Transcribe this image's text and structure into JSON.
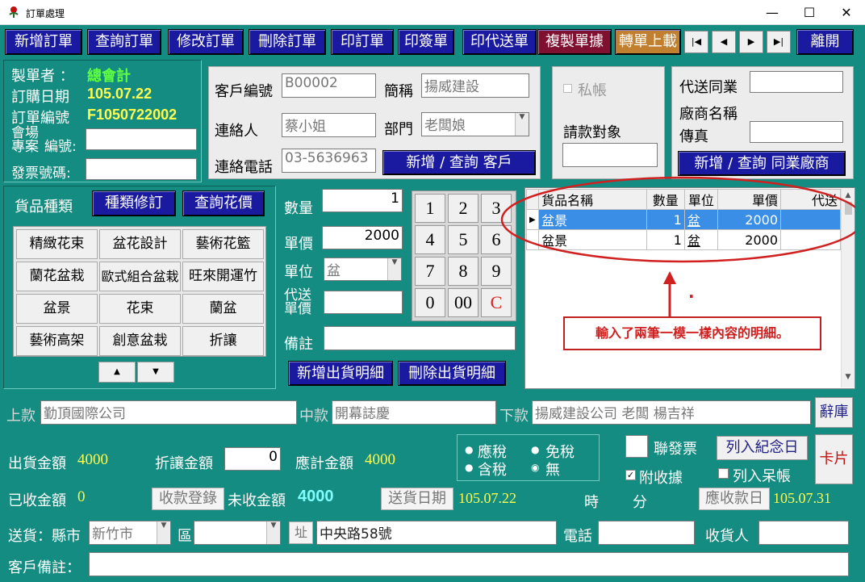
{
  "window": {
    "title": "訂單處理",
    "minimize": "—",
    "maximize": "☐",
    "close": "✕"
  },
  "toolbar": {
    "new_order": "新增訂單",
    "query_order": "查詢訂單",
    "edit_order": "修改訂單",
    "delete_order": "刪除訂單",
    "print_order": "印訂單",
    "print_sign": "印簽單",
    "print_proxy": "印代送單",
    "copy_doc": "複製單據",
    "transfer_upload": "轉單上載",
    "leave": "離開",
    "nav_first": "|◀",
    "nav_prev": "◀",
    "nav_next": "▶",
    "nav_last": "▶|"
  },
  "info": {
    "maker_label": "製單者 ：",
    "maker_value": "總會計",
    "date_label": "訂購日期",
    "date_value": "105.07.22",
    "no_label": "訂單編號",
    "no_value": "F1050722002",
    "venue_label1": "會場",
    "venue_label2": "專案",
    "venue_label3": "編號:",
    "venue_value": "",
    "invoice_label": "發票號碼:",
    "invoice_value": ""
  },
  "customer": {
    "id_label": "客戶編號",
    "id_value": "B00002",
    "short_label": "簡稱",
    "short_value": "揚威建設",
    "contact_label": "連絡人",
    "contact_value": "蔡小姐",
    "dept_label": "部門",
    "dept_value": "老闆娘",
    "phone_label": "連絡電話",
    "phone_value": "03-5636963",
    "add_query_btn": "新增 / 查詢  客戶"
  },
  "billing": {
    "private_label": "私帳",
    "target_label": "請款對象",
    "target_value": ""
  },
  "peer": {
    "peer_label": "代送同業",
    "peer_value": "",
    "vendor_label": "廠商名稱",
    "fax_label": "傳真",
    "fax_value": "",
    "add_query_btn": "新增 / 查詢  同業廠商"
  },
  "goods": {
    "category_label": "貨品種類",
    "revise_btn": "種類修訂",
    "price_btn": "查詢花價",
    "categories": [
      "精緻花束",
      "盆花設計",
      "藝術花籃",
      "蘭花盆栽",
      "歐式組合盆栽",
      "旺來開運竹",
      "盆景",
      "花束",
      "蘭盆",
      "藝術高架",
      "創意盆栽",
      "折讓"
    ],
    "scroll_up": "▲",
    "scroll_down": "▼"
  },
  "entry": {
    "qty_label": "數量",
    "qty_value": "1",
    "price_label": "單價",
    "price_value": "2000",
    "unit_label": "單位",
    "unit_value": "盆",
    "proxy_label1": "代送",
    "proxy_label2": "單價",
    "proxy_value": "",
    "note_label": "備註",
    "note_value": "",
    "add_btn": "新增出貨明細",
    "delete_btn": "刪除出貨明細"
  },
  "keypad": [
    "1",
    "2",
    "3",
    "4",
    "5",
    "6",
    "7",
    "8",
    "9",
    "0",
    "00",
    "C"
  ],
  "grid": {
    "headers": [
      "貨品名稱",
      "數量",
      "單位",
      "單價",
      "代送"
    ],
    "rows": [
      {
        "name": "盆景",
        "qty": "1",
        "unit": "盆",
        "price": "2000",
        "proxy": ""
      },
      {
        "name": "盆景",
        "qty": "1",
        "unit": "盆",
        "price": "2000",
        "proxy": ""
      }
    ]
  },
  "annotation": {
    "text": "輸入了兩筆一模一樣內容的明細。",
    "dot": "."
  },
  "greeting": {
    "upper_label": "上款",
    "upper_value": "勤頂國際公司",
    "middle_label": "中款",
    "middle_value": "開幕誌慶",
    "lower_label": "下款",
    "lower_value": "揚威建設公司 老闆 楊吉祥",
    "phrase_btn": "辭庫"
  },
  "amount": {
    "ship_label": "出貨金額",
    "ship_value": "4000",
    "discount_label": "折讓金額",
    "discount_value": "0",
    "due_label": "應計金額",
    "due_value": "4000",
    "received_label": "已收金額",
    "received_value": "0",
    "receive_btn": "收款登錄",
    "unpaid_label": "未收金額",
    "unpaid_value": "4000",
    "deliver_date_btn": "送貨日期",
    "deliver_date_value": "105.07.22",
    "hour_label": "時",
    "minute_label": "分",
    "due_date_btn": "應收款日",
    "due_date_value": "105.07.31"
  },
  "tax": {
    "taxable": "應稅",
    "exempt": "免稅",
    "tax_incl": "含稅",
    "none": "無"
  },
  "options": {
    "joint_invoice": "聯發票",
    "receipt": "附收據",
    "memorial_btn": "列入紀念日",
    "bad_debt": "列入呆帳",
    "card_btn": "卡片"
  },
  "delivery": {
    "label": "送貨：縣市",
    "city_value": "新竹市",
    "district_label": "區",
    "district_value": "",
    "addr_btn": "址",
    "addr_value": "中央路58號",
    "phone_label": "電話",
    "phone_value": "",
    "receiver_label": "收貨人",
    "receiver_value": ""
  },
  "customer_note": {
    "label": "客戶備註：",
    "value": ""
  },
  "colors": {
    "background": "#148c82",
    "button": "#1a1aa0",
    "highlight": "#ffff50",
    "annotation_red": "#d02020"
  }
}
